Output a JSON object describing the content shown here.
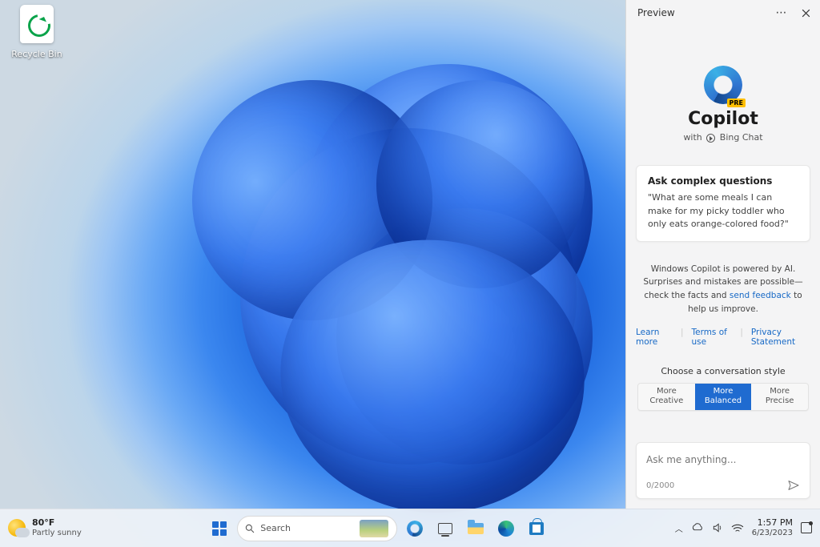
{
  "desktop": {
    "recycle_bin_label": "Recycle Bin"
  },
  "sidebar": {
    "header_label": "Preview",
    "brand_title": "Copilot",
    "brand_with_prefix": "with",
    "brand_with_suffix": "Bing Chat",
    "pre_badge": "PRE",
    "example_card": {
      "title": "Ask complex questions",
      "body": "\"What are some meals I can make for my picky toddler who only eats orange-colored food?\""
    },
    "disclosure_pre": "Windows Copilot is powered by AI. Surprises and mistakes are possible—check the facts and ",
    "disclosure_link": "send feedback",
    "disclosure_post": " to help us improve.",
    "links": {
      "learn": "Learn more",
      "terms": "Terms of use",
      "privacy": "Privacy Statement"
    },
    "style_label": "Choose a conversation style",
    "styles": {
      "creative_top": "More",
      "creative_bot": "Creative",
      "balanced_top": "More",
      "balanced_bot": "Balanced",
      "precise_top": "More",
      "precise_bot": "Precise"
    },
    "input_placeholder": "Ask me anything...",
    "input_counter": "0/2000"
  },
  "taskbar": {
    "weather_temp": "80°F",
    "weather_desc": "Partly sunny",
    "search_placeholder": "Search",
    "clock_time": "1:57 PM",
    "clock_date": "6/23/2023"
  }
}
